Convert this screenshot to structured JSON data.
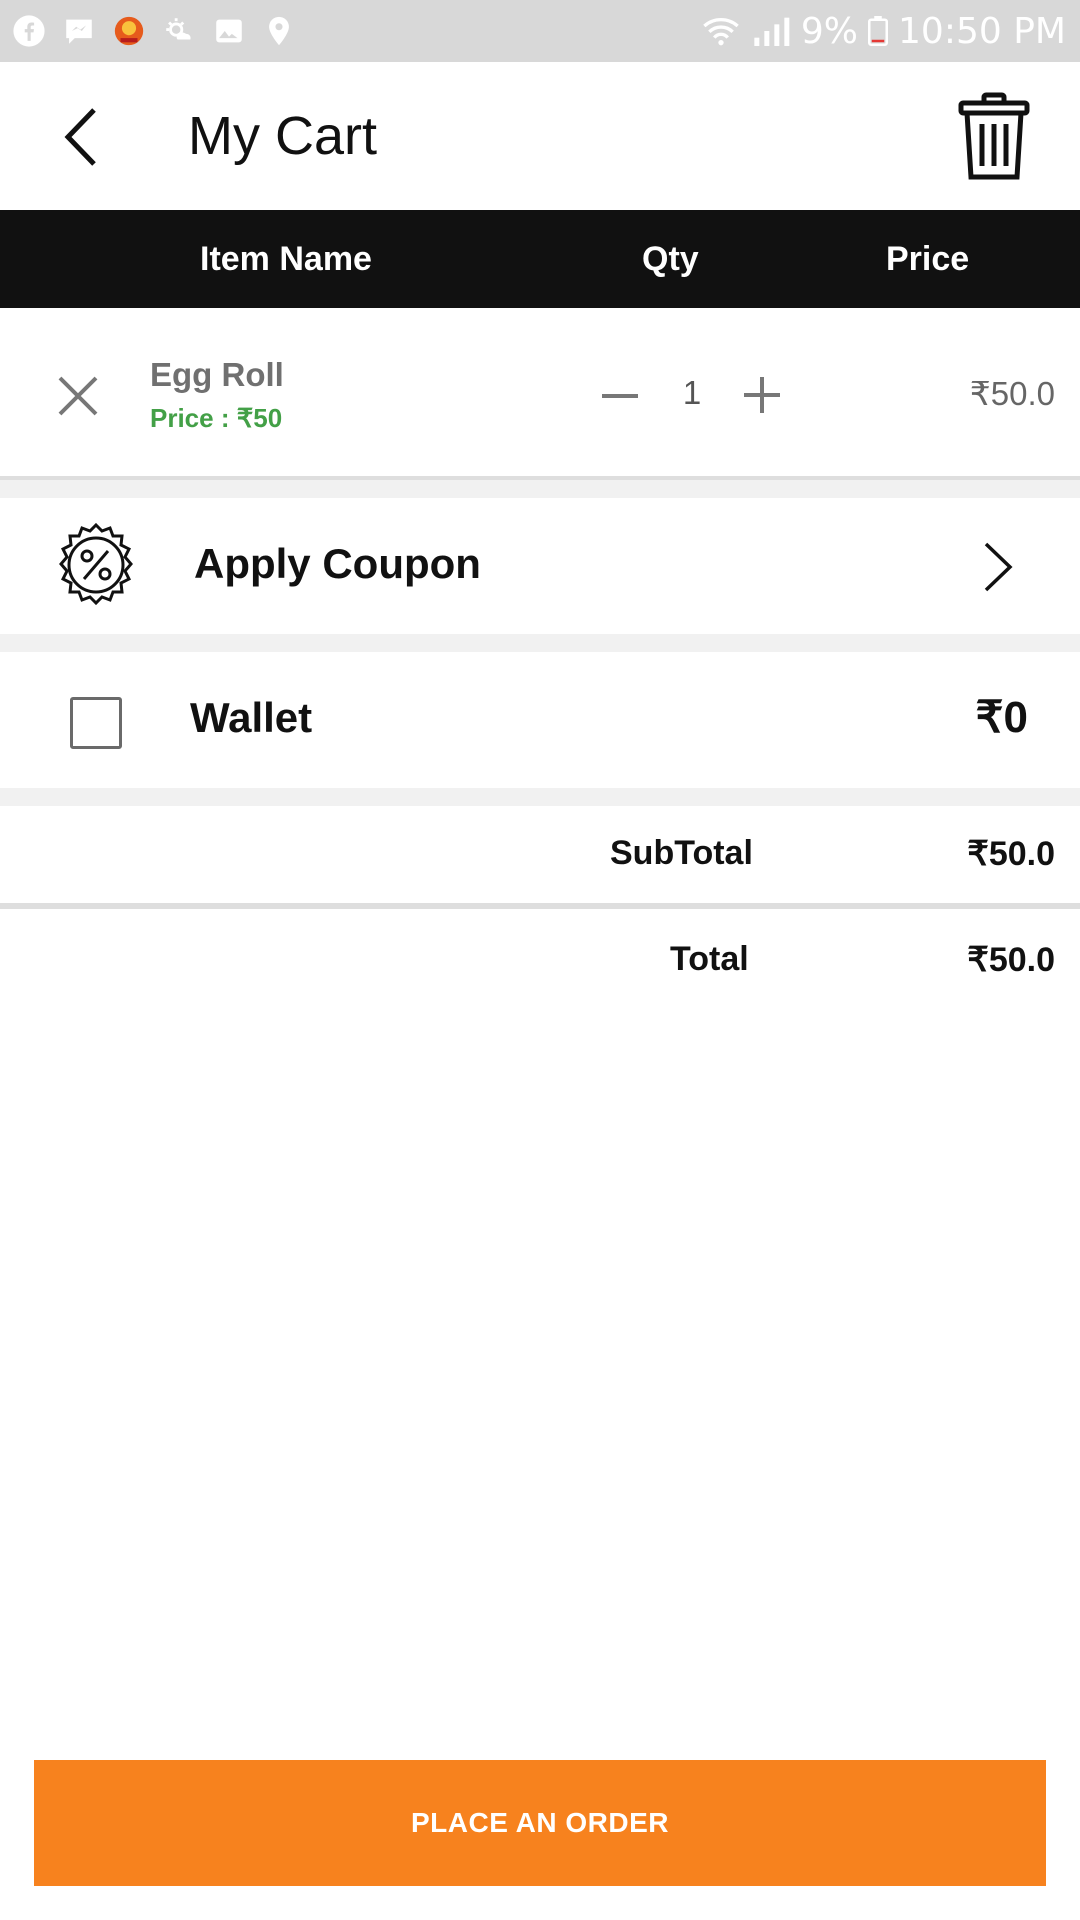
{
  "status_bar": {
    "left_icons": [
      "facebook-icon",
      "messenger-icon",
      "app-icon",
      "weather-icon",
      "gallery-icon",
      "location-icon"
    ],
    "right_icons": [
      "wifi-icon",
      "signal-icon",
      "battery-icon"
    ],
    "battery": "9%",
    "time": "10:50 PM"
  },
  "header": {
    "title": "My Cart",
    "back_icon": "chevron-left-icon",
    "clear_icon": "trash-icon"
  },
  "columns": {
    "item_name": "Item Name",
    "qty": "Qty",
    "price": "Price"
  },
  "cart_items": [
    {
      "name": "Egg Roll",
      "unit_price": "Price : ₹50",
      "qty": "1",
      "total": "₹50.0"
    }
  ],
  "coupon": {
    "label": "Apply Coupon",
    "icon": "discount-badge-icon"
  },
  "wallet": {
    "label": "Wallet",
    "amount": "₹0",
    "checked": false
  },
  "summary": {
    "subtotal_label": "SubTotal",
    "subtotal_value": "₹50.0",
    "total_label": "Total",
    "total_value": "₹50.0"
  },
  "actions": {
    "place_order": "PLACE AN ORDER"
  },
  "colors": {
    "accent": "#f7821e",
    "header_bar": "#111111",
    "price_green": "#43a047"
  }
}
